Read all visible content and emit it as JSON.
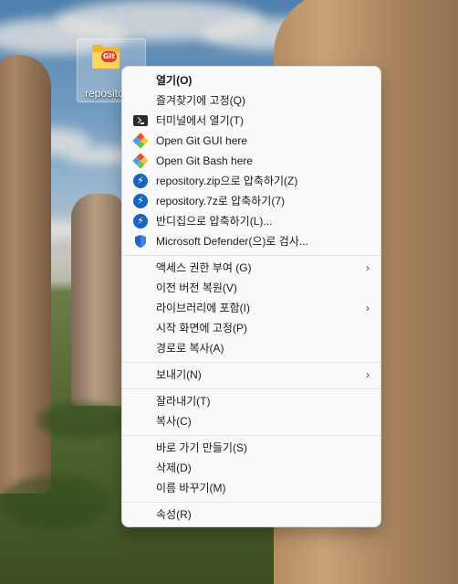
{
  "desktop": {
    "icon_label": "reposito",
    "icon_badge": "Git"
  },
  "menu": {
    "items": [
      {
        "id": "open",
        "label": "열기(O)",
        "icon": "none",
        "bold": true
      },
      {
        "id": "pin-quick-access",
        "label": "즐겨찾기에 고정(Q)",
        "icon": "none"
      },
      {
        "id": "open-terminal",
        "label": "터미널에서 열기(T)",
        "icon": "terminal-icon"
      },
      {
        "id": "git-gui",
        "label": "Open Git GUI here",
        "icon": "git-icon"
      },
      {
        "id": "git-bash",
        "label": "Open Git Bash here",
        "icon": "git-icon"
      },
      {
        "id": "zip",
        "label": "repository.zip으로 압축하기(Z)",
        "icon": "bandizip-icon"
      },
      {
        "id": "7z",
        "label": "repository.7z로 압축하기(7)",
        "icon": "bandizip-icon"
      },
      {
        "id": "bandizip",
        "label": "반디집으로 압축하기(L)...",
        "icon": "bandizip-icon"
      },
      {
        "id": "defender",
        "label": "Microsoft Defender(으)로 검사...",
        "icon": "shield-icon"
      },
      {
        "id": "access",
        "label": "액세스 권한 부여 (G)",
        "submenu": true
      },
      {
        "id": "restore",
        "label": "이전 버전 복원(V)"
      },
      {
        "id": "library",
        "label": "라이브러리에 포함(I)",
        "submenu": true
      },
      {
        "id": "pin-start",
        "label": "시작 화면에 고정(P)"
      },
      {
        "id": "copy-path",
        "label": "경로로 복사(A)"
      },
      {
        "id": "send-to",
        "label": "보내기(N)",
        "submenu": true
      },
      {
        "id": "cut",
        "label": "잘라내기(T)"
      },
      {
        "id": "copy",
        "label": "복사(C)"
      },
      {
        "id": "shortcut",
        "label": "바로 가기 만들기(S)"
      },
      {
        "id": "delete",
        "label": "삭제(D)"
      },
      {
        "id": "rename",
        "label": "이름 바꾸기(M)"
      },
      {
        "id": "properties",
        "label": "속성(R)"
      }
    ]
  }
}
